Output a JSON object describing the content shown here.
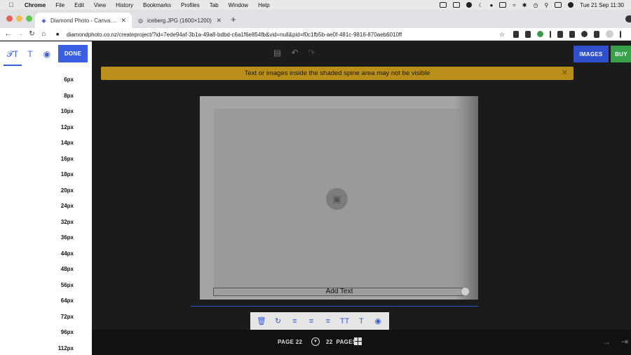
{
  "menubar": {
    "items": [
      "Chrome",
      "File",
      "Edit",
      "View",
      "History",
      "Bookmarks",
      "Profiles",
      "Tab",
      "Window",
      "Help"
    ],
    "clock": "Tue 21 Sep  11:30"
  },
  "tabs": [
    {
      "title": "Diamond Photo - Canvas Print"
    },
    {
      "title": "iceberg.JPG (1600×1200)"
    }
  ],
  "address": {
    "url": "diamondphoto.co.nz/createproject/?id=7ede94af-3b1a-49a8-bdbd-c6a1f6e854fb&vid=null&pid=f0c1fb5b-ae0f-481c-9816-870aeb6010ff"
  },
  "sidebar": {
    "done_label": "DONE",
    "font_sizes": [
      "6px",
      "8px",
      "10px",
      "12px",
      "14px",
      "16px",
      "18px",
      "20px",
      "24px",
      "32px",
      "36px",
      "44px",
      "48px",
      "56px",
      "64px",
      "72px",
      "96px",
      "112px"
    ]
  },
  "editor": {
    "images_label": "IMAGES",
    "buy_label": "BUY",
    "banner_text": "Text or images inside the shaded spine area may not be visible",
    "add_text": "Add Text",
    "page_label": "PAGE 22",
    "page_count": "22",
    "pages_label": "PAGES"
  },
  "colors": {
    "accent": "#3a5fe0",
    "buy": "#38a04a",
    "banner": "#b98f1a",
    "canvas_bg": "#1b1b1b"
  }
}
